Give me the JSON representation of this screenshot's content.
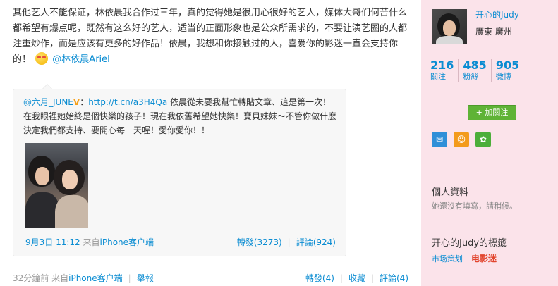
{
  "post": {
    "text": "其他艺人不能保证，林依晨我合作过三年，真的觉得她是很用心很好的艺人，媒体大哥们何苦什么都希望有爆点呢，既然有这么好的艺人，适当的正面形象也是公众所需求的，不要让演艺圈的人都注重炒作，而是应该有更多的好作品！依晨，我想和你接触过的人，喜爱你的影迷一直会支持你的！",
    "mention": "@林依晨Ariel"
  },
  "repost": {
    "author": "@六月_JUNE",
    "badge": "V",
    "link": "http://t.cn/a3H4Qa",
    "text": " 依晨從未要我幫忙轉貼文章、這是第一次！在我眼裡她始終是個快樂的孩子！現在我依舊希望她快樂！寶貝妹妹～不管你做什麼決定我們都支持、要開心每一天喔！愛你愛你！！",
    "time": "9月3日 11:12",
    "source_prefix": "来自",
    "source": "iPhone客户端",
    "forward": "轉發(3273)",
    "comment": "評論(924)"
  },
  "footer": {
    "time": "32分鐘前",
    "source_prefix": "来自",
    "source": "iPhone客户端",
    "report": "舉報",
    "forward": "轉發(4)",
    "favorite": "收藏",
    "comment": "評論(4)"
  },
  "sidebar": {
    "name": "开心的Judy",
    "location": "廣東  廣州",
    "stats": [
      {
        "num": "216",
        "label": "關注"
      },
      {
        "num": "485",
        "label": "粉絲"
      },
      {
        "num": "905",
        "label": "微博"
      }
    ],
    "follow_label": "+ 加關注",
    "info_title": "個人資料",
    "info_text": "她還沒有填寫，請稍候。",
    "tags_title": "开心的Judy的標籤",
    "tags": [
      "市场策划",
      "电影迷"
    ]
  },
  "colors": {
    "link": "#0a8cd2",
    "sidebar_bg": "#fbe3ea",
    "follow_button": "#5fb336",
    "tag_highlight": "#e2452e"
  }
}
